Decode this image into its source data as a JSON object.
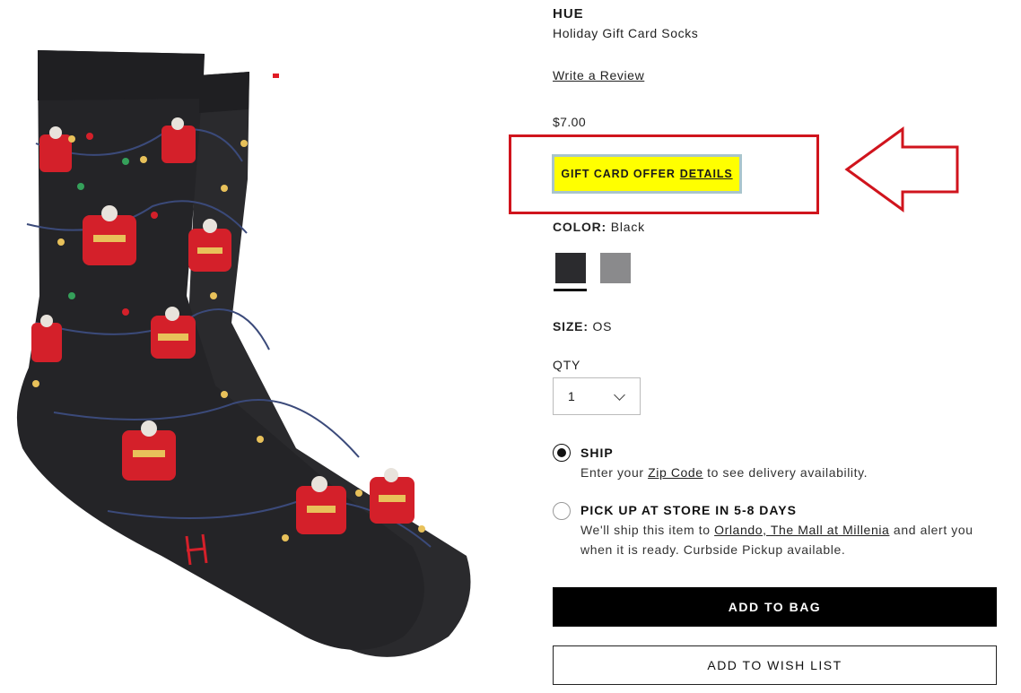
{
  "product": {
    "brand": "HUE",
    "name": "Holiday Gift Card Socks",
    "write_review": "Write a Review",
    "price": "$7.00"
  },
  "offer": {
    "label": "GIFT CARD OFFER",
    "details_link": "DETAILS"
  },
  "color": {
    "label": "COLOR:",
    "selected": "Black",
    "swatches": [
      {
        "name": "Black",
        "hex": "#2b2b2e"
      },
      {
        "name": "Gray",
        "hex": "#8a8a8c"
      }
    ]
  },
  "size": {
    "label": "SIZE:",
    "value": "OS"
  },
  "qty": {
    "label": "QTY",
    "value": "1"
  },
  "delivery": {
    "ship": {
      "title": "SHIP",
      "text_before": "Enter your ",
      "link": "Zip Code",
      "text_after": " to see delivery availability.",
      "selected": true
    },
    "pickup": {
      "title": "PICK UP AT STORE IN 5-8 DAYS",
      "text_before": "We'll ship this item to ",
      "link": "Orlando, The Mall at Millenia",
      "text_after": " and alert you when it is ready. Curbside Pickup available.",
      "selected": false
    }
  },
  "buttons": {
    "add_to_bag": "ADD TO BAG",
    "add_to_wish_list": "ADD TO WISH LIST"
  },
  "colors": {
    "offer_bg": "#ffff00",
    "annotation_red": "#d0141d",
    "sock": "#2b2b2e"
  }
}
